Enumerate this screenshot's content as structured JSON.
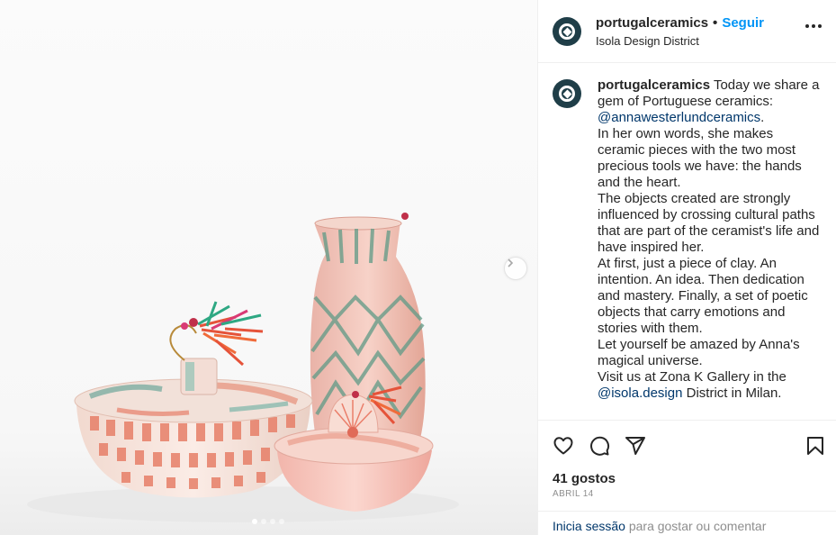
{
  "post": {
    "username": "portugalceramics",
    "separator": "•",
    "follow_label": "Seguir",
    "location": "Isola Design District",
    "caption_username": "portugalceramics",
    "caption_lines": {
      "l1": "Today we share a gem of Portuguese ceramics:",
      "mention1": "@annawesterlundceramics",
      "l1_end": ".",
      "l2": "In her own words, she makes ceramic pieces with the two most precious tools we have: the hands and the heart.",
      "l3": "The objects created are strongly influenced by crossing cultural paths that are part of the ceramist's life and have inspired her.",
      "l4": "At first, just a piece of clay. An intention. An idea. Then dedication and mastery. Finally, a set of poetic objects that carry emotions and stories with them.",
      "l5": "Let yourself be amazed by Anna's magical universe.",
      "l6": "Visit us at Zona K Gallery in the",
      "mention2": "@isola.design",
      "l6_end": "District in Milan."
    },
    "likes": "41 gostos",
    "date": "ABRIL 14",
    "login_link": "Inicia sessão",
    "login_rest": "para gostar ou comentar",
    "carousel": {
      "slides": 4,
      "active": 1
    }
  },
  "icons": {
    "heart": "heart-icon",
    "comment": "comment-icon",
    "share": "share-icon",
    "save": "bookmark-icon",
    "more": "more-options-icon",
    "next": "chevron-right-icon"
  },
  "colors": {
    "link": "#0095f6",
    "mention": "#00376b",
    "avatar": "#1f3e48",
    "muted": "#8e8e8e"
  }
}
